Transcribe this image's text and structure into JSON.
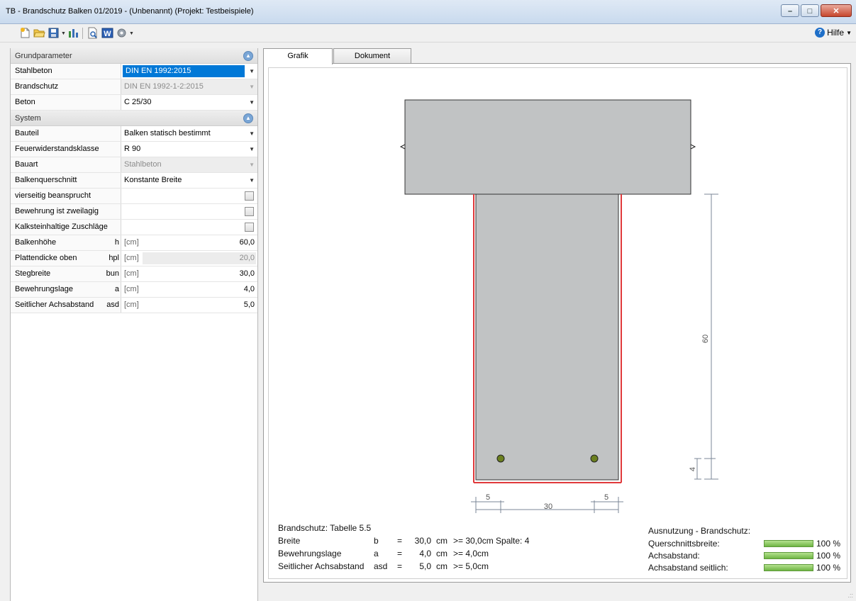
{
  "window": {
    "title": "TB - Brandschutz Balken 01/2019 - (Unbenannt) (Projekt: Testbeispiele)"
  },
  "toolbar": {
    "help_label": "Hilfe"
  },
  "sections": [
    {
      "label": "Grundparameter"
    },
    {
      "label": "System"
    }
  ],
  "grund": [
    {
      "name": "Stahlbeton",
      "value": "DIN EN 1992:2015"
    },
    {
      "name": "Brandschutz",
      "value": "DIN EN 1992-1-2:2015"
    },
    {
      "name": "Beton",
      "value": "C 25/30"
    }
  ],
  "system": [
    {
      "name": "Bauteil",
      "value": "Balken statisch bestimmt"
    },
    {
      "name": "Feuerwiderstandsklasse",
      "value": "R  90"
    },
    {
      "name": "Bauart",
      "value": "Stahlbeton"
    },
    {
      "name": "Balkenquerschnitt",
      "value": "Konstante Breite"
    }
  ],
  "checks": [
    {
      "name": "vierseitig beansprucht"
    },
    {
      "name": "Bewehrung ist zweilagig"
    },
    {
      "name": "Kalksteinhaltige Zuschläge"
    }
  ],
  "numeric": [
    {
      "name": "Balkenhöhe",
      "sym": "h",
      "unit": "[cm]",
      "value": "60,0"
    },
    {
      "name": "Plattendicke oben",
      "sym": "hpl",
      "unit": "[cm]",
      "value": "20,0"
    },
    {
      "name": "Stegbreite",
      "sym": "bun",
      "unit": "[cm]",
      "value": "30,0"
    },
    {
      "name": "Bewehrungslage",
      "sym": "a",
      "unit": "[cm]",
      "value": "4,0"
    },
    {
      "name": "Seitlicher Achsabstand",
      "sym": "asd",
      "unit": "[cm]",
      "value": "5,0"
    }
  ],
  "tabs": [
    {
      "label": "Grafik"
    },
    {
      "label": "Dokument"
    }
  ],
  "drawing": {
    "dim_height": "60",
    "dim_a": "4",
    "dim_left": "5",
    "dim_right": "5",
    "dim_width": "30"
  },
  "results": {
    "heading": "Brandschutz: Tabelle 5.5",
    "rows": [
      {
        "label": "Breite",
        "sym": "b",
        "eq": "=",
        "val": "30,0",
        "unit": "cm",
        "cmp": ">= 30,0cm Spalte: 4"
      },
      {
        "label": "Bewehrungslage",
        "sym": "a",
        "eq": "=",
        "val": "4,0",
        "unit": "cm",
        "cmp": ">= 4,0cm"
      },
      {
        "label": "Seitlicher Achsabstand",
        "sym": "asd",
        "eq": "=",
        "val": "5,0",
        "unit": "cm",
        "cmp": ">= 5,0cm"
      }
    ]
  },
  "utilization": {
    "heading": "Ausnutzung - Brandschutz:",
    "rows": [
      {
        "label": "Querschnittsbreite:",
        "pct": "100 %",
        "fraction": 1.0
      },
      {
        "label": "Achsabstand:",
        "pct": "100 %",
        "fraction": 1.0
      },
      {
        "label": "Achsabstand seitlich:",
        "pct": "100 %",
        "fraction": 1.0
      }
    ]
  },
  "colors": {
    "accent": "#0078d7",
    "concrete": "#c1c3c4",
    "fire": "#e0393b",
    "rebar": "#6b7f1f",
    "bar": "#7dbd4f"
  }
}
